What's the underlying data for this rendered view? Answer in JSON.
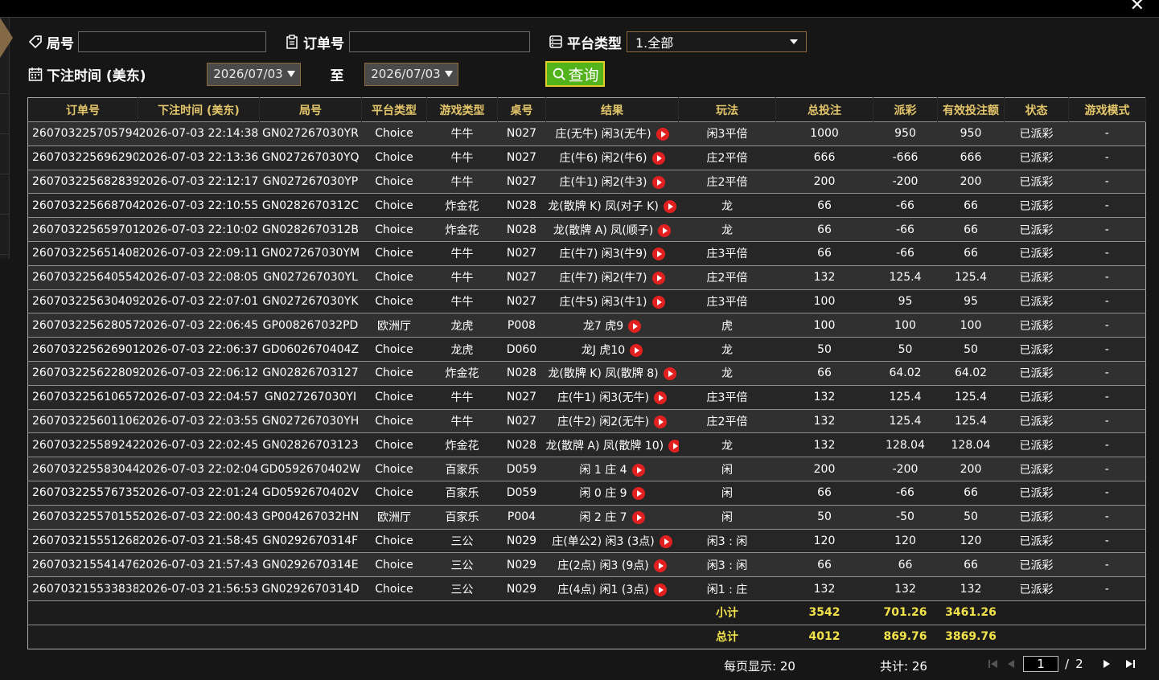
{
  "colors": {
    "accent": "#e4c66a",
    "win": "#46d12b",
    "loss": "#d61818",
    "query_btn": "#52b31a",
    "total_text": "#f3e34a"
  },
  "filters": {
    "round_label": "局号",
    "round_value": "",
    "order_label": "订单号",
    "order_value": "",
    "platform_label": "平台类型",
    "platform_value": "1.全部",
    "time_label": "下注时间 (美东)",
    "date_from": "2026/07/03",
    "to_label": "至",
    "date_to": "2026/07/03",
    "query_label": "查询"
  },
  "table": {
    "headers": [
      "订单号",
      "下注时间 (美东)",
      "局号",
      "平台类型",
      "游戏类型",
      "桌号",
      "结果",
      "玩法",
      "总投注",
      "派彩",
      "有效投注额",
      "状态",
      "游戏模式"
    ],
    "rows": [
      {
        "order": "260703225705794",
        "time": "2026-07-03 22:14:38",
        "round": "GN027267030YR",
        "platform": "Choice",
        "game": "牛牛",
        "table": "N027",
        "result": "庄(无牛) 闲3(无牛)",
        "play": "闲3平倍",
        "bet": "1000",
        "payout": "950",
        "payout_type": "neg",
        "valid": "950",
        "status": "已派彩",
        "mode": "-"
      },
      {
        "order": "260703225696290",
        "time": "2026-07-03 22:13:36",
        "round": "GN027267030YQ",
        "platform": "Choice",
        "game": "牛牛",
        "table": "N027",
        "result": "庄(牛6) 闲2(牛6)",
        "play": "庄2平倍",
        "bet": "666",
        "payout": "-666",
        "payout_type": "pos",
        "valid": "666",
        "status": "已派彩",
        "mode": "-"
      },
      {
        "order": "260703225682839",
        "time": "2026-07-03 22:12:17",
        "round": "GN027267030YP",
        "platform": "Choice",
        "game": "牛牛",
        "table": "N027",
        "result": "庄(牛1) 闲2(牛3)",
        "play": "庄2平倍",
        "bet": "200",
        "payout": "-200",
        "payout_type": "pos",
        "valid": "200",
        "status": "已派彩",
        "mode": "-"
      },
      {
        "order": "260703225668704",
        "time": "2026-07-03 22:10:55",
        "round": "GN0282670312C",
        "platform": "Choice",
        "game": "炸金花",
        "table": "N028",
        "result": "龙(散牌 K) 凤(对子 K)",
        "play": "龙",
        "bet": "66",
        "payout": "-66",
        "payout_type": "pos",
        "valid": "66",
        "status": "已派彩",
        "mode": "-"
      },
      {
        "order": "260703225659701",
        "time": "2026-07-03 22:10:02",
        "round": "GN0282670312B",
        "platform": "Choice",
        "game": "炸金花",
        "table": "N028",
        "result": "龙(散牌 A) 凤(顺子)",
        "play": "龙",
        "bet": "66",
        "payout": "-66",
        "payout_type": "pos",
        "valid": "66",
        "status": "已派彩",
        "mode": "-"
      },
      {
        "order": "260703225651408",
        "time": "2026-07-03 22:09:11",
        "round": "GN027267030YM",
        "platform": "Choice",
        "game": "牛牛",
        "table": "N027",
        "result": "庄(牛7) 闲3(牛9)",
        "play": "庄3平倍",
        "bet": "66",
        "payout": "-66",
        "payout_type": "pos",
        "valid": "66",
        "status": "已派彩",
        "mode": "-"
      },
      {
        "order": "260703225640554",
        "time": "2026-07-03 22:08:05",
        "round": "GN027267030YL",
        "platform": "Choice",
        "game": "牛牛",
        "table": "N027",
        "result": "庄(牛7) 闲2(牛7)",
        "play": "庄2平倍",
        "bet": "132",
        "payout": "125.4",
        "payout_type": "neg",
        "valid": "125.4",
        "status": "已派彩",
        "mode": "-"
      },
      {
        "order": "260703225630409",
        "time": "2026-07-03 22:07:01",
        "round": "GN027267030YK",
        "platform": "Choice",
        "game": "牛牛",
        "table": "N027",
        "result": "庄(牛5) 闲3(牛1)",
        "play": "庄3平倍",
        "bet": "100",
        "payout": "95",
        "payout_type": "neg",
        "valid": "95",
        "status": "已派彩",
        "mode": "-"
      },
      {
        "order": "260703225628057",
        "time": "2026-07-03 22:06:45",
        "round": "GP008267032PD",
        "platform": "欧洲厅",
        "game": "龙虎",
        "table": "P008",
        "result": "龙7 虎9",
        "play": "虎",
        "bet": "100",
        "payout": "100",
        "payout_type": "neg",
        "valid": "100",
        "status": "已派彩",
        "mode": "-"
      },
      {
        "order": "260703225626901",
        "time": "2026-07-03 22:06:37",
        "round": "GD0602670404Z",
        "platform": "Choice",
        "game": "龙虎",
        "table": "D060",
        "result": "龙J 虎10",
        "play": "龙",
        "bet": "50",
        "payout": "50",
        "payout_type": "neg",
        "valid": "50",
        "status": "已派彩",
        "mode": "-"
      },
      {
        "order": "260703225622809",
        "time": "2026-07-03 22:06:12",
        "round": "GN02826703127",
        "platform": "Choice",
        "game": "炸金花",
        "table": "N028",
        "result": "龙(散牌 K) 凤(散牌 8)",
        "play": "龙",
        "bet": "66",
        "payout": "64.02",
        "payout_type": "neg",
        "valid": "64.02",
        "status": "已派彩",
        "mode": "-"
      },
      {
        "order": "260703225610657",
        "time": "2026-07-03 22:04:57",
        "round": "GN027267030YI",
        "platform": "Choice",
        "game": "牛牛",
        "table": "N027",
        "result": "庄(牛1) 闲3(无牛)",
        "play": "庄3平倍",
        "bet": "132",
        "payout": "125.4",
        "payout_type": "neg",
        "valid": "125.4",
        "status": "已派彩",
        "mode": "-"
      },
      {
        "order": "260703225601106",
        "time": "2026-07-03 22:03:55",
        "round": "GN027267030YH",
        "platform": "Choice",
        "game": "牛牛",
        "table": "N027",
        "result": "庄(牛2) 闲2(无牛)",
        "play": "庄2平倍",
        "bet": "132",
        "payout": "125.4",
        "payout_type": "neg",
        "valid": "125.4",
        "status": "已派彩",
        "mode": "-"
      },
      {
        "order": "260703225589242",
        "time": "2026-07-03 22:02:45",
        "round": "GN02826703123",
        "platform": "Choice",
        "game": "炸金花",
        "table": "N028",
        "result": "龙(散牌 A) 凤(散牌 10)",
        "play": "龙",
        "bet": "132",
        "payout": "128.04",
        "payout_type": "neg",
        "valid": "128.04",
        "status": "已派彩",
        "mode": "-"
      },
      {
        "order": "260703225583044",
        "time": "2026-07-03 22:02:04",
        "round": "GD0592670402W",
        "platform": "Choice",
        "game": "百家乐",
        "table": "D059",
        "result": "闲 1 庄 4",
        "play": "闲",
        "bet": "200",
        "payout": "-200",
        "payout_type": "pos",
        "valid": "200",
        "status": "已派彩",
        "mode": "-"
      },
      {
        "order": "260703225576735",
        "time": "2026-07-03 22:01:24",
        "round": "GD0592670402V",
        "platform": "Choice",
        "game": "百家乐",
        "table": "D059",
        "result": "闲 0 庄 9",
        "play": "闲",
        "bet": "66",
        "payout": "-66",
        "payout_type": "pos",
        "valid": "66",
        "status": "已派彩",
        "mode": "-"
      },
      {
        "order": "260703225570155",
        "time": "2026-07-03 22:00:43",
        "round": "GP004267032HN",
        "platform": "欧洲厅",
        "game": "百家乐",
        "table": "P004",
        "result": "闲 2 庄 7",
        "play": "闲",
        "bet": "50",
        "payout": "-50",
        "payout_type": "pos",
        "valid": "50",
        "status": "已派彩",
        "mode": "-"
      },
      {
        "order": "260703215551268",
        "time": "2026-07-03 21:58:45",
        "round": "GN0292670314F",
        "platform": "Choice",
        "game": "三公",
        "table": "N029",
        "result": "庄(单公2) 闲3 (3点)",
        "play": "闲3 : 闲",
        "bet": "120",
        "payout": "120",
        "payout_type": "neg",
        "valid": "120",
        "status": "已派彩",
        "mode": "-"
      },
      {
        "order": "260703215541476",
        "time": "2026-07-03 21:57:43",
        "round": "GN0292670314E",
        "platform": "Choice",
        "game": "三公",
        "table": "N029",
        "result": "庄(2点) 闲3 (9点)",
        "play": "闲3 : 闲",
        "bet": "66",
        "payout": "66",
        "payout_type": "neg",
        "valid": "66",
        "status": "已派彩",
        "mode": "-"
      },
      {
        "order": "260703215533838",
        "time": "2026-07-03 21:56:53",
        "round": "GN0292670314D",
        "platform": "Choice",
        "game": "三公",
        "table": "N029",
        "result": "庄(4点) 闲1 (3点)",
        "play": "闲1 : 庄",
        "bet": "132",
        "payout": "132",
        "payout_type": "neg",
        "valid": "132",
        "status": "已派彩",
        "mode": "-"
      }
    ],
    "subtotal": {
      "label": "小计",
      "bet": "3542",
      "payout": "701.26",
      "valid": "3461.26"
    },
    "total": {
      "label": "总计",
      "bet": "4012",
      "payout": "869.76",
      "valid": "3869.76"
    }
  },
  "footer": {
    "per_page": "每页显示: 20",
    "total_count": "共计: 26",
    "current_page": "1",
    "page_sep": "/",
    "total_pages": "2"
  }
}
